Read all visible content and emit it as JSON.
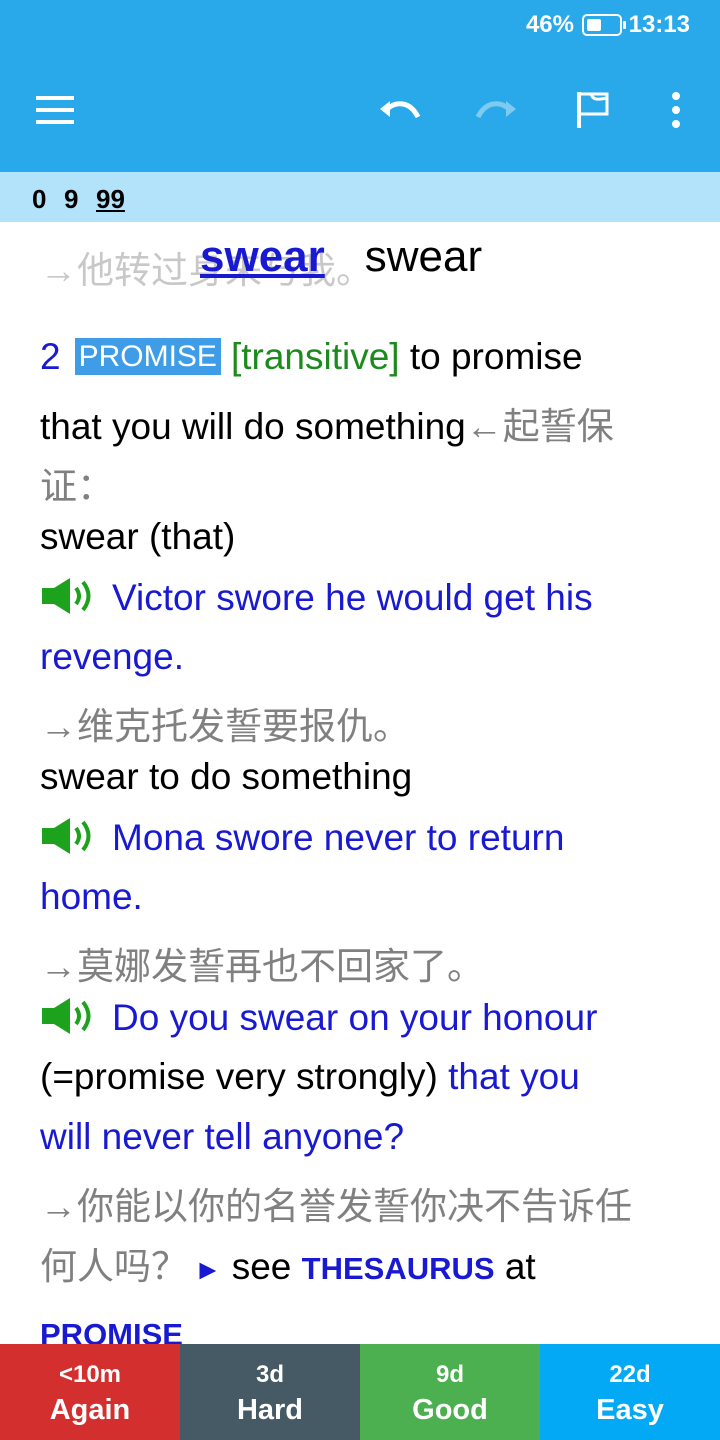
{
  "status_bar": {
    "battery": "46%",
    "time": "13:13"
  },
  "toolbar": {
    "menu_icon": "hamburger-menu-icon",
    "undo_icon": "undo-icon",
    "redo_icon": "redo-icon",
    "flag_icon": "flag-icon",
    "more_icon": "more-vert-icon"
  },
  "counts": {
    "new": "0",
    "learning": "9",
    "review": "99"
  },
  "card": {
    "ghost_text": "→他转过身来与我。",
    "headword_link": "swear",
    "headword": "swear",
    "sense_number": "2",
    "signpost": "PROMISE",
    "grammar": "[transitive]",
    "def_a": "to promise",
    "def_b": "that you will do something",
    "def_zh_a": "←起誓保",
    "def_zh_b": "证：",
    "pattern1": "swear (that)",
    "ex1_a": "Victor swore he would get his",
    "ex1_b": "revenge.",
    "ex1_zh": "→维克托发誓要报仇。",
    "pattern2": "swear to do something",
    "ex2_a": "Mona swore never to return",
    "ex2_b": "home.",
    "ex2_zh": "→莫娜发誓再也不回家了。",
    "ex3_a": "Do you swear on your honour",
    "ex3_gloss": "(=promise very strongly)",
    "ex3_b": "that you",
    "ex3_c": "will never tell anyone?",
    "ex3_zh_a": "→你能以你的名誉发誓你决不告诉任",
    "ex3_zh_b": "何人吗？",
    "see_label": "see",
    "thesaurus": "THESAURUS",
    "at_label": "at",
    "promise_link": "PROMISE"
  },
  "answer_buttons": [
    {
      "interval": "<10m",
      "label": "Again"
    },
    {
      "interval": "3d",
      "label": "Hard"
    },
    {
      "interval": "9d",
      "label": "Good"
    },
    {
      "interval": "22d",
      "label": "Easy"
    }
  ],
  "colors": {
    "toolbar": "#29a8ea",
    "counts_bar": "#b3e3fb",
    "again": "#d32f2f",
    "hard": "#455a64",
    "good": "#4caf50",
    "easy": "#03a9f4",
    "example_text": "#1919d2",
    "grammar": "#1c8a1c",
    "translation": "#808080"
  }
}
